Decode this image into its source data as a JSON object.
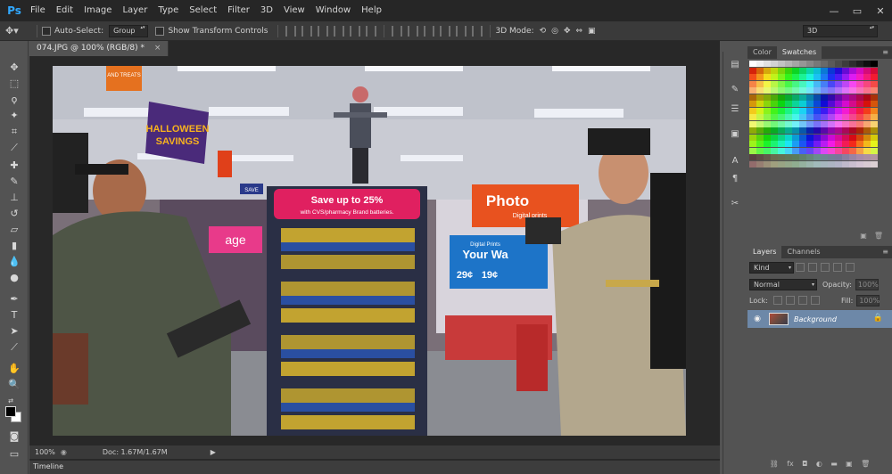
{
  "app": {
    "logo": "Ps"
  },
  "menu": [
    "File",
    "Edit",
    "Image",
    "Layer",
    "Type",
    "Select",
    "Filter",
    "3D",
    "View",
    "Window",
    "Help"
  ],
  "window_controls": {
    "minimize": "—",
    "maximize": "▭",
    "close": "✕"
  },
  "options": {
    "auto_select_label": "Auto-Select:",
    "auto_select_value": "Group",
    "transform_label": "Show Transform Controls",
    "mode_label": "3D Mode:",
    "workspace": "3D"
  },
  "document": {
    "tab_title": "074.JPG @ 100% (RGB/8) *",
    "close": "×",
    "image": {
      "signs": {
        "treats": "AND TREATS",
        "halloween": "HALLOWEEN",
        "savings": "SAVINGS",
        "save": "SAVE",
        "promo": "Save up to 25%",
        "promo_sub": "with CVS/pharmacy Brand batteries.",
        "photo": "Photo",
        "photo_sub": "Digital prints",
        "prints_title": "Digital Prints",
        "your_way": "Your Wa",
        "price1": "29¢",
        "price2": "19¢",
        "age": "age"
      }
    }
  },
  "status": {
    "zoom": "100%",
    "doc_size": "Doc: 1.67M/1.67M",
    "arrow": "▶"
  },
  "timeline": {
    "label": "Timeline"
  },
  "swatch_panel": {
    "tabs": [
      "Color",
      "Swatches"
    ],
    "active": "Swatches",
    "menu": "≡"
  },
  "layers_panel": {
    "tabs": [
      "Layers",
      "Channels"
    ],
    "active": "Layers",
    "menu": "≡",
    "kind_label": "Kind",
    "blend_mode": "Normal",
    "opacity_label": "Opacity:",
    "opacity_value": "100%",
    "lock_label": "Lock:",
    "fill_label": "Fill:",
    "fill_value": "100%",
    "layers": [
      {
        "name": "Background",
        "visible": true,
        "locked": true
      }
    ],
    "footer_icons": [
      "link-icon",
      "fx-icon",
      "mask-icon",
      "adjustment-icon",
      "folder-icon",
      "new-layer-icon",
      "trash-icon"
    ]
  },
  "colors": {
    "accent_blue": "#31a8ff",
    "selected_layer": "#6d88a8"
  }
}
